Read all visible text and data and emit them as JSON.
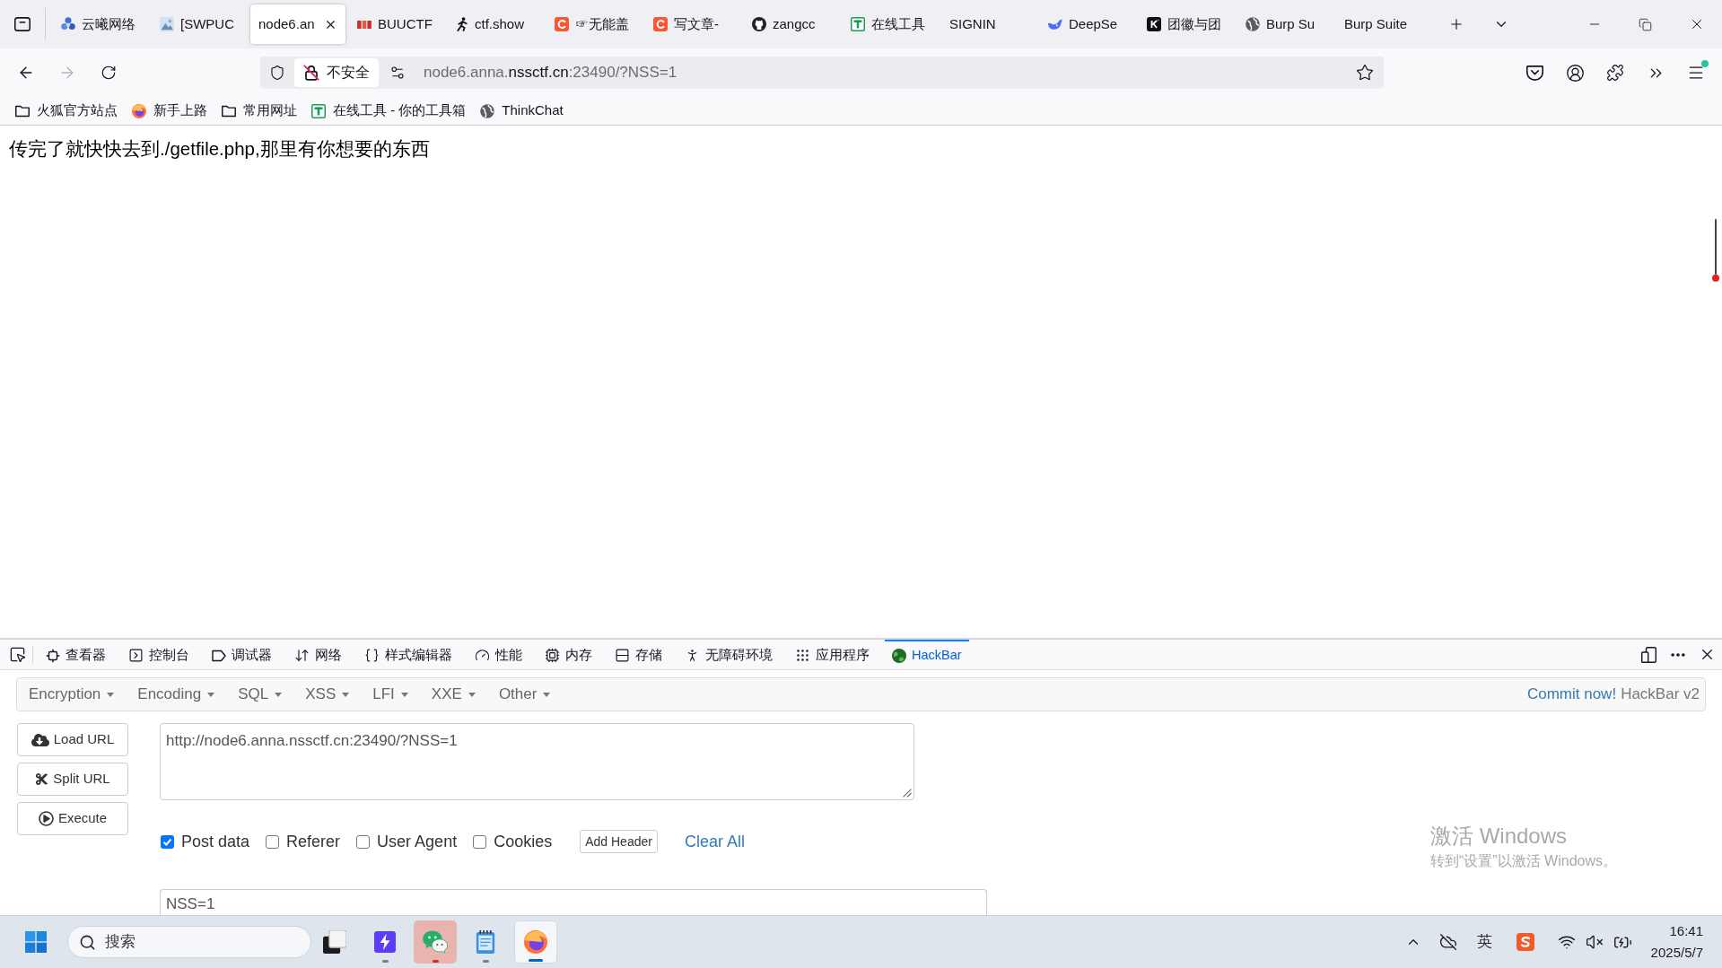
{
  "tab_strip": {
    "tabs": [
      {
        "title": "云曦网络",
        "kind": "flower",
        "selected": false
      },
      {
        "title": "[SWPUC",
        "kind": "picture",
        "selected": false
      },
      {
        "title": "node6.an",
        "kind": "blank",
        "selected": true
      },
      {
        "title": "BUUCTF",
        "kind": "bars",
        "selected": false
      },
      {
        "title": "ctf.show",
        "kind": "runner",
        "selected": false
      },
      {
        "title": "☞无能盖",
        "kind": "arc",
        "selected": false
      },
      {
        "title": "写文章-",
        "kind": "arc",
        "selected": false
      },
      {
        "title": "zangcc",
        "kind": "cat",
        "selected": false
      },
      {
        "title": "在线工具",
        "kind": "ttile",
        "selected": false
      },
      {
        "title": "SIGNIN",
        "kind": "blank",
        "selected": false
      },
      {
        "title": "DeepSe",
        "kind": "whale",
        "selected": false
      },
      {
        "title": "团徽与团",
        "kind": "ktile",
        "selected": false
      },
      {
        "title": "Burp Su",
        "kind": "globe",
        "selected": false
      },
      {
        "title": "Burp Suite",
        "kind": "blank",
        "selected": false
      }
    ]
  },
  "navigation": {
    "security_label": "不安全",
    "address": {
      "subdomain": "node6.anna.",
      "domain": "nssctf.cn",
      "path": ":23490/?NSS=1"
    }
  },
  "bookmarks": [
    {
      "label": "火狐官方站点",
      "kind": "folder"
    },
    {
      "label": "新手上路",
      "kind": "browser"
    },
    {
      "label": "常用网址",
      "kind": "folder"
    },
    {
      "label": "在线工具 - 你的工具箱",
      "kind": "ttile"
    },
    {
      "label": "ThinkChat",
      "kind": "globe"
    }
  ],
  "page": {
    "message": "传完了就快快去到./getfile.php,那里有你想要的东西"
  },
  "devtools": {
    "tabs": [
      {
        "label": "查看器",
        "kind": "inspector",
        "selected": false
      },
      {
        "label": "控制台",
        "kind": "console",
        "selected": false
      },
      {
        "label": "调试器",
        "kind": "debugger",
        "selected": false
      },
      {
        "label": "网络",
        "kind": "network",
        "selected": false
      },
      {
        "label": "样式编辑器",
        "kind": "style",
        "selected": false
      },
      {
        "label": "性能",
        "kind": "performance",
        "selected": false
      },
      {
        "label": "内存",
        "kind": "memory",
        "selected": false
      },
      {
        "label": "存储",
        "kind": "storage",
        "selected": false
      },
      {
        "label": "无障碍环境",
        "kind": "accessibility",
        "selected": false
      },
      {
        "label": "应用程序",
        "kind": "application",
        "selected": false
      },
      {
        "label": "HackBar",
        "kind": "hackbar",
        "selected": true
      }
    ],
    "hackbar": {
      "menus": [
        "Encryption",
        "Encoding",
        "SQL",
        "XSS",
        "LFI",
        "XXE",
        "Other"
      ],
      "commit_link": "Commit now!",
      "version": "HackBar v2",
      "buttons": [
        {
          "label": "Load URL",
          "kind": "load"
        },
        {
          "label": "Split URL",
          "kind": "split"
        },
        {
          "label": "Execute",
          "kind": "execute"
        }
      ],
      "url": "http://node6.anna.nssctf.cn:23490/?NSS=1",
      "options": [
        {
          "label": "Post data",
          "checked": true
        },
        {
          "label": "Referer",
          "checked": false
        },
        {
          "label": "User Agent",
          "checked": false
        },
        {
          "label": "Cookies",
          "checked": false
        }
      ],
      "add_header": "Add Header",
      "clear_all": "Clear All",
      "post_data": "NSS=1"
    }
  },
  "taskbar": {
    "search": {
      "placeholder": "搜索"
    },
    "apps": [
      {
        "kind": "stack",
        "running": false,
        "attention": false,
        "active": false
      },
      {
        "kind": "bolt",
        "running": true,
        "attention": false,
        "active": false
      },
      {
        "kind": "chat",
        "running": true,
        "attention": true,
        "active": false
      },
      {
        "kind": "notepad",
        "running": true,
        "attention": false,
        "active": false
      },
      {
        "kind": "browser",
        "running": true,
        "attention": false,
        "active": true
      }
    ],
    "input_mode": "英",
    "time": "16:41",
    "date": "2025/5/7"
  },
  "activation_notice": {
    "title": "激活 Windows",
    "hint": "转到“设置”以激活 Windows。"
  }
}
